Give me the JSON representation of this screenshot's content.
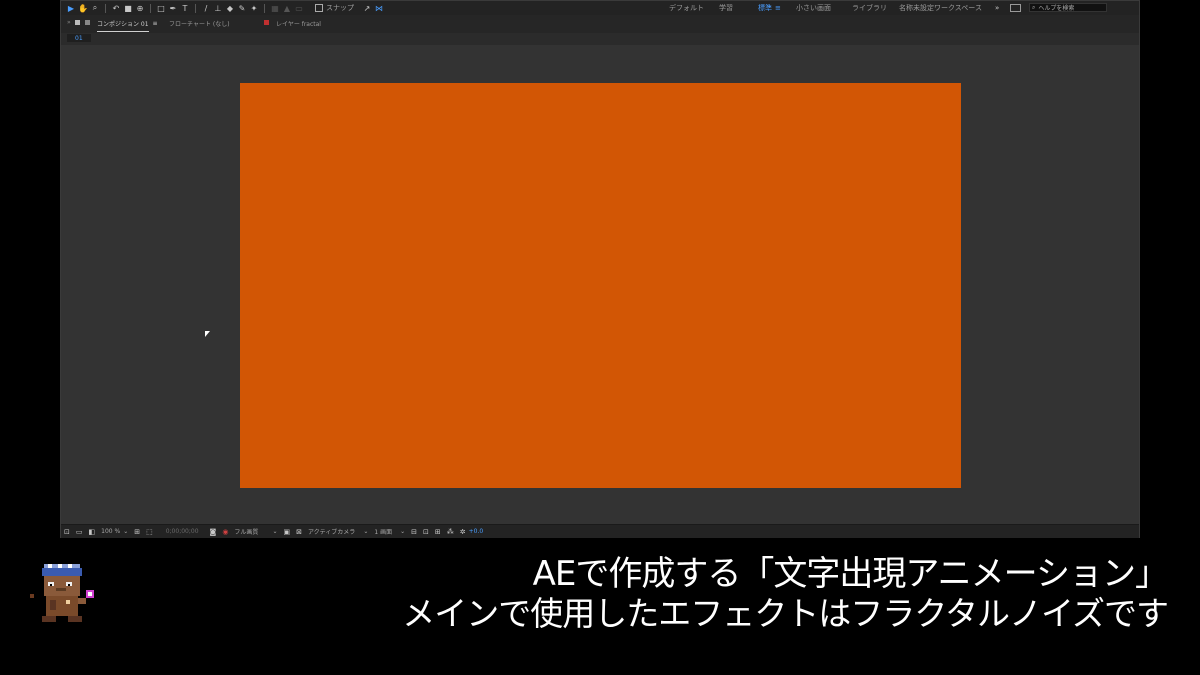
{
  "toolbar": {
    "snap_label": "スナップ",
    "workspaces": [
      "デフォルト",
      "学習",
      "標準",
      "小さい画面",
      "ライブラリ",
      "名称未設定ワークスペース"
    ],
    "active_workspace": "標準",
    "search_placeholder": "ヘルプを検索",
    "accent": "#4a9eff"
  },
  "panel": {
    "tabs": [
      {
        "label": "コンポジション 01",
        "active": true
      },
      {
        "label": "フローチャート (なし)",
        "active": false
      },
      {
        "label": "レイヤー fractal",
        "active": false
      }
    ],
    "breadcrumb": "01"
  },
  "viewer": {
    "composition_color": "#d25605",
    "background_color": "#333333"
  },
  "bottom_bar": {
    "zoom": "100 %",
    "timecode": "0;00;00;00",
    "resolution": "フル画質",
    "camera": "アクティブカメラ",
    "views": "1 画面",
    "exposure": "+0.0"
  },
  "subtitles": {
    "line1": "AEで作成する「文字出現アニメーション」",
    "line2": "メインで使用したエフェクトはフラクタルノイズです"
  }
}
